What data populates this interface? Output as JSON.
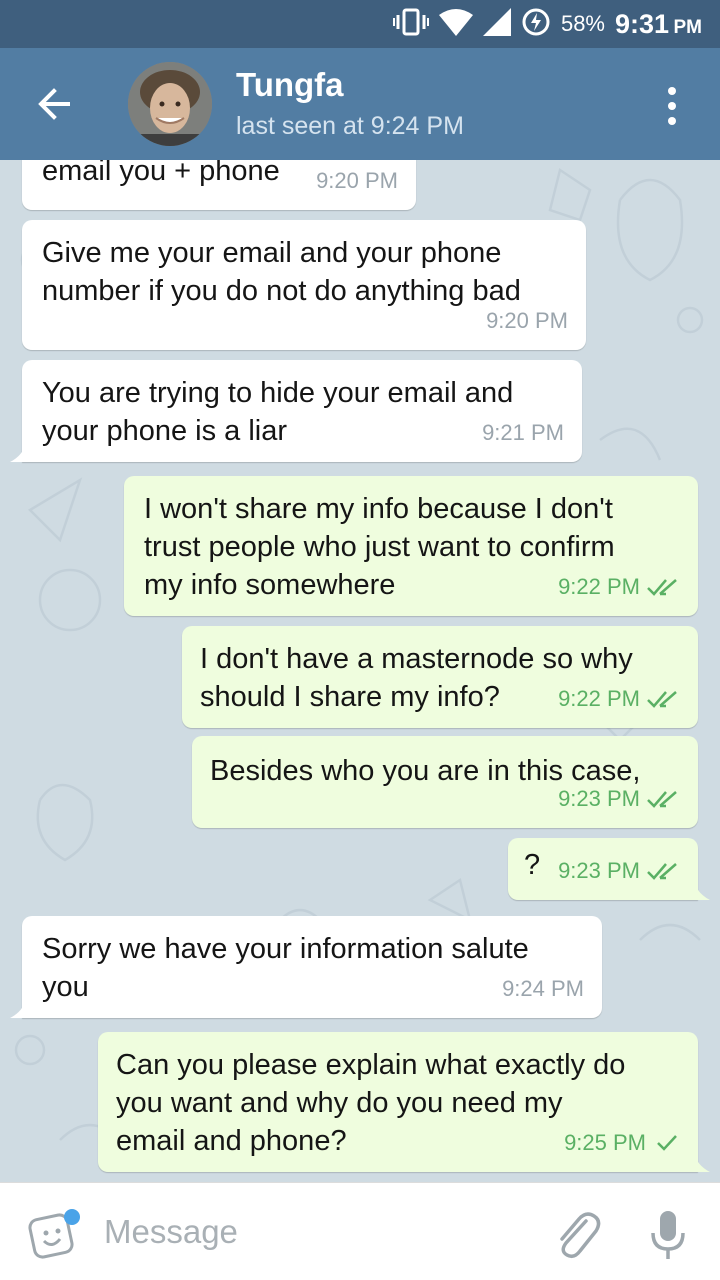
{
  "status_bar": {
    "battery_percent": "58%",
    "time": "9:31",
    "ampm": "PM"
  },
  "header": {
    "contact_name": "Tungfa",
    "last_seen": "last seen at 9:24 PM"
  },
  "messages": [
    {
      "dir": "in",
      "text": "email you + phone",
      "time": "9:20 PM"
    },
    {
      "dir": "in",
      "text": "Give me your email and your phone\nnumber if you do not do anything bad",
      "time": "9:20 PM"
    },
    {
      "dir": "in",
      "text": "You are trying to hide your email and\nyour phone is a liar",
      "time": "9:21 PM"
    },
    {
      "dir": "out",
      "text": "I won't share my info because I don't\ntrust people who just want to confirm\nmy info somewhere",
      "time": "9:22 PM",
      "status": "read"
    },
    {
      "dir": "out",
      "text": "I don't have a masternode so why\nshould I share my info?",
      "time": "9:22 PM",
      "status": "read"
    },
    {
      "dir": "out",
      "text": "Besides who you are in this case,",
      "time": "9:23 PM",
      "status": "read"
    },
    {
      "dir": "out",
      "text": "?",
      "time": "9:23 PM",
      "status": "read"
    },
    {
      "dir": "in",
      "text": "Sorry we have your information salute\nyou",
      "time": "9:24 PM"
    },
    {
      "dir": "out",
      "text": "Can you please explain what exactly do\nyou want and why do you need my\nemail and phone?",
      "time": "9:25 PM",
      "status": "sent"
    }
  ],
  "composer": {
    "placeholder": "Message"
  },
  "icons": {
    "back": "arrow-left-icon",
    "menu": "more-vertical-icon",
    "emoji": "sticker-icon",
    "attach": "paperclip-icon",
    "mic": "microphone-icon",
    "read_receipt": "double-check-icon",
    "sent_receipt": "check-icon"
  },
  "colors": {
    "header": "#527da3",
    "status_bar": "#3f5f7e",
    "incoming_bubble": "#ffffff",
    "outgoing_bubble": "#effdde",
    "check_color": "#5ab064"
  }
}
